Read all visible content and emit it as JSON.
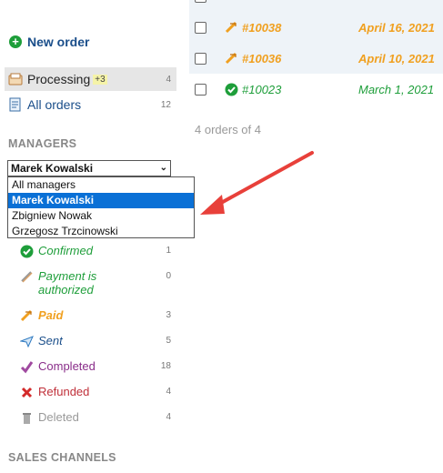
{
  "sidebar": {
    "new_order": "New order",
    "nav": [
      {
        "label": "Processing",
        "badge": "+3",
        "count": "4"
      },
      {
        "label": "All orders",
        "count": "12"
      }
    ],
    "managers_title": "MANAGERS",
    "manager_select": {
      "value": "Marek Kowalski",
      "options": [
        "All managers",
        "Marek Kowalski",
        "Zbigniew Nowak",
        "Grzegosz Trzcinowski"
      ]
    },
    "statuses": [
      {
        "label": "Confirmed",
        "count": "1",
        "color": "#1e9e3a"
      },
      {
        "label": "Payment is authorized",
        "count": "0",
        "color": "#1e9e3a"
      },
      {
        "label": "Paid",
        "count": "3",
        "color": "#f0a020"
      },
      {
        "label": "Sent",
        "count": "5",
        "color": "#1a4e8a"
      },
      {
        "label": "Completed",
        "count": "18",
        "color": "#8a2e8a"
      },
      {
        "label": "Refunded",
        "count": "4",
        "color": "#c0303a"
      },
      {
        "label": "Deleted",
        "count": "4",
        "color": "#999999"
      }
    ],
    "sales_channels_title": "SALES CHANNELS"
  },
  "orders": [
    {
      "id": "#10038",
      "date": "April 16, 2021",
      "color": "#f0a020",
      "icon": "paid-icon"
    },
    {
      "id": "#10036",
      "date": "April 10, 2021",
      "color": "#f0a020",
      "icon": "paid-icon"
    },
    {
      "id": "#10023",
      "date": "March 1, 2021",
      "color": "#1e9e3a",
      "icon": "confirmed-icon"
    }
  ],
  "orders_count_text": "4 orders of 4"
}
